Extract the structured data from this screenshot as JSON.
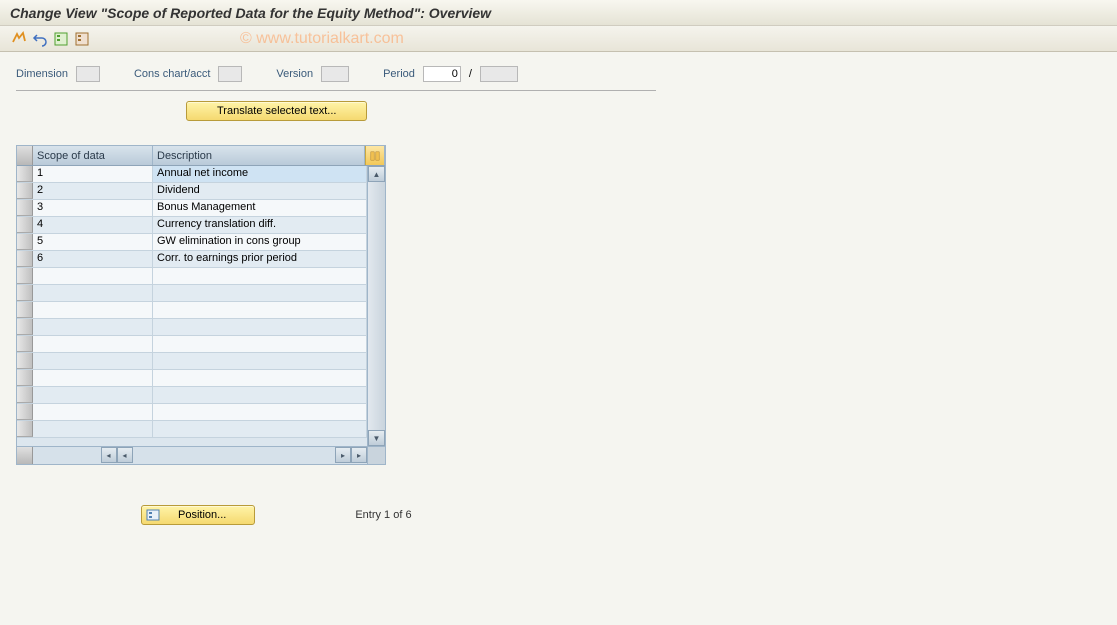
{
  "header": {
    "title": "Change View \"Scope of Reported Data for the Equity Method\": Overview"
  },
  "watermark": "© www.tutorialkart.com",
  "filters": {
    "dimension_label": "Dimension",
    "dimension_value": "",
    "cons_label": "Cons chart/acct",
    "cons_value": "",
    "version_label": "Version",
    "version_value": "",
    "period_label": "Period",
    "period_value": "0",
    "period_sep": "/",
    "period_value2": ""
  },
  "buttons": {
    "translate": "Translate selected text...",
    "position": "Position..."
  },
  "table": {
    "columns": {
      "scope": "Scope of data",
      "desc": "Description"
    },
    "rows": [
      {
        "scope": "1",
        "desc": "Annual net income"
      },
      {
        "scope": "2",
        "desc": "Dividend"
      },
      {
        "scope": "3",
        "desc": "Bonus Management"
      },
      {
        "scope": "4",
        "desc": "Currency translation diff."
      },
      {
        "scope": "5",
        "desc": "GW elimination in cons group"
      },
      {
        "scope": "6",
        "desc": "Corr. to earnings prior period"
      }
    ]
  },
  "footer": {
    "entry_text": "Entry 1 of 6"
  }
}
